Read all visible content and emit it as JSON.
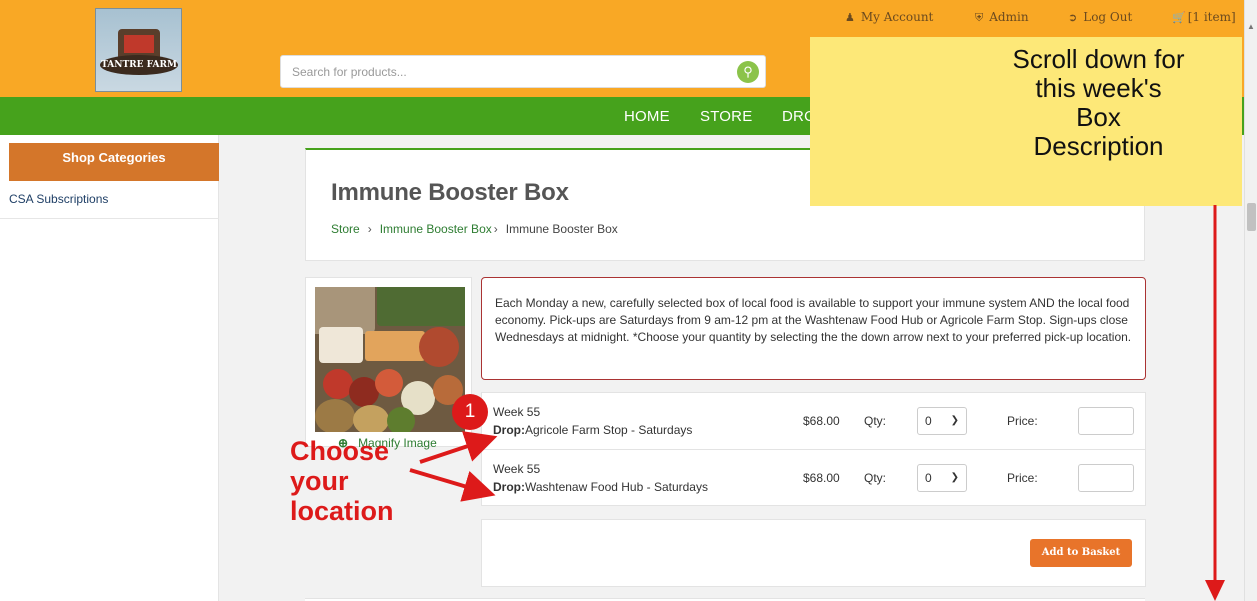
{
  "header": {
    "search_placeholder": "Search for products...",
    "utility": [
      {
        "icon": "user-icon",
        "label": "My Account"
      },
      {
        "icon": "shield-icon",
        "label": "Admin"
      },
      {
        "icon": "logout-icon",
        "label": "Log Out"
      },
      {
        "icon": "cart-icon",
        "label": "[1 item]"
      }
    ],
    "logo_text": "TANTRE FARM"
  },
  "nav": {
    "items": [
      "HOME",
      "STORE",
      "DRO"
    ]
  },
  "sidebar": {
    "heading": "Shop Categories",
    "items": [
      "CSA Subscriptions"
    ]
  },
  "product": {
    "title": "Immune Booster Box",
    "breadcrumb": [
      "Store",
      "Immune Booster Box",
      "Immune Booster Box"
    ],
    "magnify_label": "Magnify Image",
    "description": "Each Monday a new, carefully selected box of local food is available to support your immune system AND the local food economy. Pick-ups are Saturdays from 9 am-12 pm at the Washtenaw Food Hub or Agricole Farm Stop. Sign-ups close Wednesdays at midnight. *Choose your quantity by selecting the the down arrow next to your preferred pick-up location.",
    "rows": [
      {
        "week": "Week 55",
        "drop_label": "Drop:",
        "drop_value": "Agricole Farm Stop - Saturdays",
        "price": "$68.00",
        "qty_label": "Qty:",
        "qty_value": "0",
        "price_label": "Price:"
      },
      {
        "week": "Week 55",
        "drop_label": "Drop:",
        "drop_value": "Washtenaw Food Hub - Saturdays",
        "price": "$68.00",
        "qty_label": "Qty:",
        "qty_value": "0",
        "price_label": "Price:"
      }
    ],
    "add_button": "Add to Basket"
  },
  "annotations": {
    "note_lines": [
      "Scroll down for",
      "this week's",
      "Box",
      "Description"
    ],
    "badge": "1",
    "choose_lines": [
      "Choose",
      "your",
      "location"
    ],
    "red_color": "#dd1a1a",
    "note_color": "#fde878"
  }
}
